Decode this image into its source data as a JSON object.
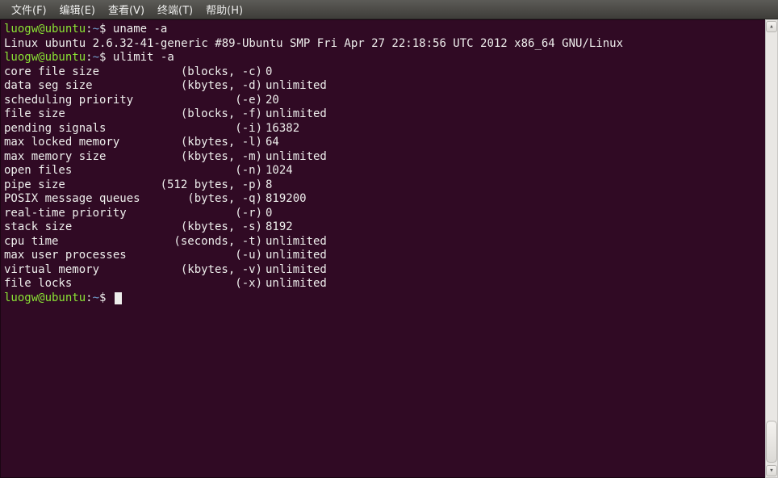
{
  "menubar": {
    "file": "文件(F)",
    "edit": "编辑(E)",
    "view": "查看(V)",
    "term": "终端(T)",
    "help": "帮助(H)"
  },
  "prompt": {
    "user_host": "luogw@ubuntu",
    "sep": ":",
    "path": "~",
    "sym": "$"
  },
  "cmd1": "uname -a",
  "uname_out": "Linux ubuntu 2.6.32-41-generic #89-Ubuntu SMP Fri Apr 27 22:18:56 UTC 2012 x86_64 GNU/Linux",
  "cmd2": "ulimit -a",
  "ulimit": [
    {
      "name": "core file size",
      "unit": "(blocks, -c)",
      "val": "0"
    },
    {
      "name": "data seg size",
      "unit": "(kbytes, -d)",
      "val": "unlimited"
    },
    {
      "name": "scheduling priority",
      "unit": "(-e)",
      "val": "20"
    },
    {
      "name": "file size",
      "unit": "(blocks, -f)",
      "val": "unlimited"
    },
    {
      "name": "pending signals",
      "unit": "(-i)",
      "val": "16382"
    },
    {
      "name": "max locked memory",
      "unit": "(kbytes, -l)",
      "val": "64"
    },
    {
      "name": "max memory size",
      "unit": "(kbytes, -m)",
      "val": "unlimited"
    },
    {
      "name": "open files",
      "unit": "(-n)",
      "val": "1024"
    },
    {
      "name": "pipe size",
      "unit": "(512 bytes, -p)",
      "val": "8"
    },
    {
      "name": "POSIX message queues",
      "unit": "(bytes, -q)",
      "val": "819200"
    },
    {
      "name": "real-time priority",
      "unit": "(-r)",
      "val": "0"
    },
    {
      "name": "stack size",
      "unit": "(kbytes, -s)",
      "val": "8192"
    },
    {
      "name": "cpu time",
      "unit": "(seconds, -t)",
      "val": "unlimited"
    },
    {
      "name": "max user processes",
      "unit": "(-u)",
      "val": "unlimited"
    },
    {
      "name": "virtual memory",
      "unit": "(kbytes, -v)",
      "val": "unlimited"
    },
    {
      "name": "file locks",
      "unit": "(-x)",
      "val": "unlimited"
    }
  ]
}
